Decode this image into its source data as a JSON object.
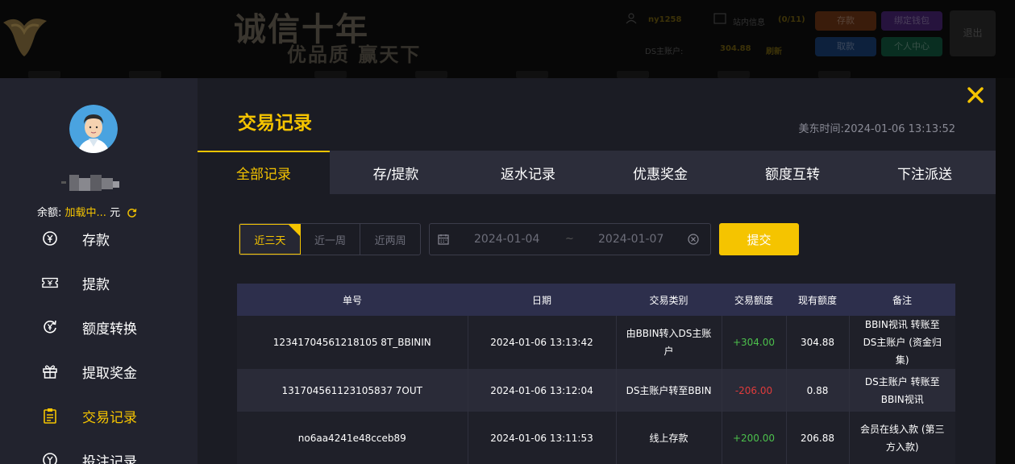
{
  "header": {
    "slogan_line1": "诚信十年",
    "slogan_line2": "优品质  赢天下",
    "username": "ny1258",
    "messages_label": "站内信息",
    "messages_count": "(0/11)",
    "main_account_label": "DS主账户:",
    "main_account_value": "304.88",
    "refresh_label": "刷新",
    "btn_deposit": "存款",
    "btn_bind": "绑定钱包",
    "btn_withdraw": "取款",
    "btn_center": "个人中心",
    "btn_logout": "退出",
    "colors": {
      "deposit": "#c4561f",
      "bind": "#7a3fc0",
      "withdraw": "#2b6cc8",
      "center": "#1c9a6a"
    }
  },
  "sidebar": {
    "balance_label": "余额:",
    "balance_value": "加载中...",
    "balance_unit": "元",
    "items": [
      {
        "label": "存款",
        "icon": "yen-circle-icon"
      },
      {
        "label": "提款",
        "icon": "ticket-icon"
      },
      {
        "label": "额度转换",
        "icon": "exchange-yen-icon"
      },
      {
        "label": "提取奖金",
        "icon": "gift-icon"
      },
      {
        "label": "交易记录",
        "icon": "clipboard-icon",
        "active": true
      },
      {
        "label": "投注记录",
        "icon": "bet-record-icon"
      }
    ]
  },
  "main": {
    "title": "交易记录",
    "us_time_label": "美东时间:",
    "us_time_value": "2024-01-06 13:13:52",
    "tabs": [
      "全部记录",
      "存/提款",
      "返水记录",
      "优惠奖金",
      "额度互转",
      "下注派送"
    ],
    "active_tab": 0,
    "ranges": [
      "近三天",
      "近一周",
      "近两周"
    ],
    "active_range": 0,
    "date_start": "2024-01-04",
    "date_sep": "~",
    "date_end": "2024-01-07",
    "submit_label": "提交",
    "accent": "#f5c400"
  },
  "table": {
    "headers": [
      "单号",
      "日期",
      "交易类别",
      "交易额度",
      "现有额度",
      "备注"
    ],
    "rows": [
      {
        "id": "12341704561218105 8T_BBININ",
        "date": "2024-01-06 13:13:42",
        "type": "由BBIN转入DS主账户",
        "amount": "+304.00",
        "balance": "304.88",
        "note": "BBIN视讯 转账至 DS主账户 (资金归集)"
      },
      {
        "id": "131704561123105837 7OUT",
        "date": "2024-01-06 13:12:04",
        "type": "DS主账户转至BBIN",
        "amount": "-206.00",
        "balance": "0.88",
        "note": "DS主账户 转账至 BBIN视讯"
      },
      {
        "id": "no6aa4241e48cceb89",
        "date": "2024-01-06 13:11:53",
        "type": "线上存款",
        "amount": "+200.00",
        "balance": "206.88",
        "note": "会员在线入款 (第三方入款)"
      }
    ]
  }
}
